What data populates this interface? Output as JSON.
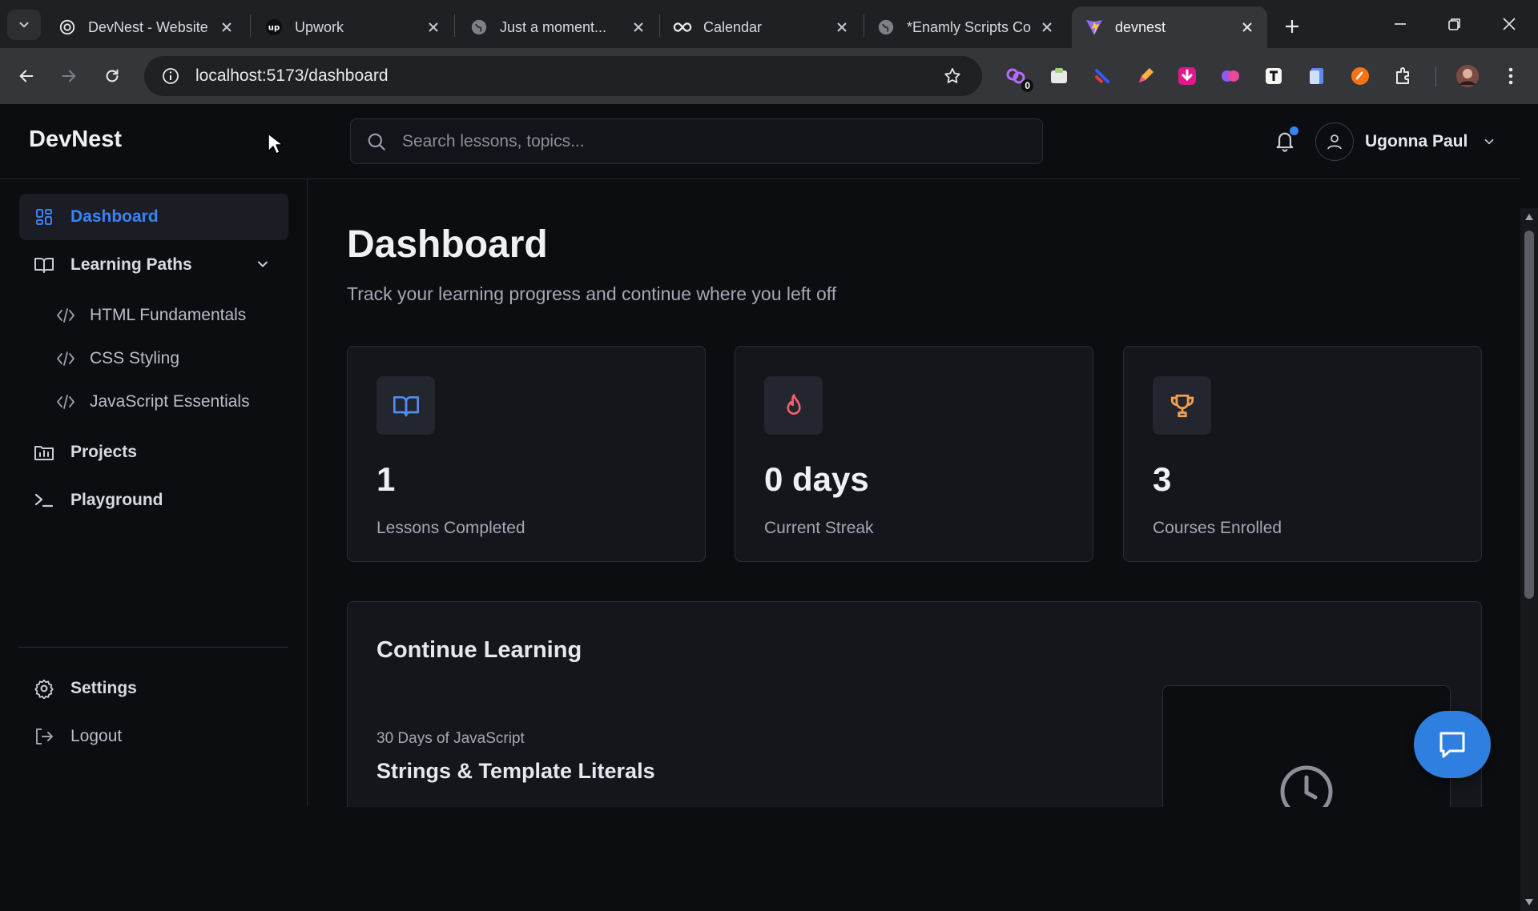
{
  "browser": {
    "tabs": [
      {
        "title": "DevNest - Website",
        "favicon": "openai-icon"
      },
      {
        "title": "Upwork",
        "favicon": "upwork-icon"
      },
      {
        "title": "Just a moment...",
        "favicon": "globe-icon"
      },
      {
        "title": "Calendar",
        "favicon": "infinity-icon"
      },
      {
        "title": "*Enamly Scripts Co",
        "favicon": "globe-icon"
      },
      {
        "title": "devnest",
        "favicon": "vite-icon",
        "active": true
      }
    ],
    "url": "localhost:5173/dashboard",
    "extension_badge": "0"
  },
  "app": {
    "brand": "DevNest",
    "search_placeholder": "Search lessons, topics...",
    "user_name": "Ugonna Paul",
    "accent_color": "#3b82f6"
  },
  "sidebar": {
    "dashboard": "Dashboard",
    "learning_paths": "Learning Paths",
    "sub_items": [
      "HTML Fundamentals",
      "CSS Styling",
      "JavaScript Essentials"
    ],
    "projects": "Projects",
    "playground": "Playground",
    "settings": "Settings",
    "logout": "Logout"
  },
  "main": {
    "title": "Dashboard",
    "subtitle": "Track your learning progress and continue where you left off",
    "stats": [
      {
        "value": "1",
        "label": "Lessons Completed",
        "icon": "book-open-icon",
        "color": "#4f8df5"
      },
      {
        "value": "0 days",
        "label": "Current Streak",
        "icon": "flame-icon",
        "color": "#f2606b"
      },
      {
        "value": "3",
        "label": "Courses Enrolled",
        "icon": "trophy-icon",
        "color": "#f0a052"
      }
    ],
    "continue": {
      "title": "Continue Learning",
      "course": "30 Days of JavaScript",
      "lesson": "Strings & Template Literals"
    }
  }
}
